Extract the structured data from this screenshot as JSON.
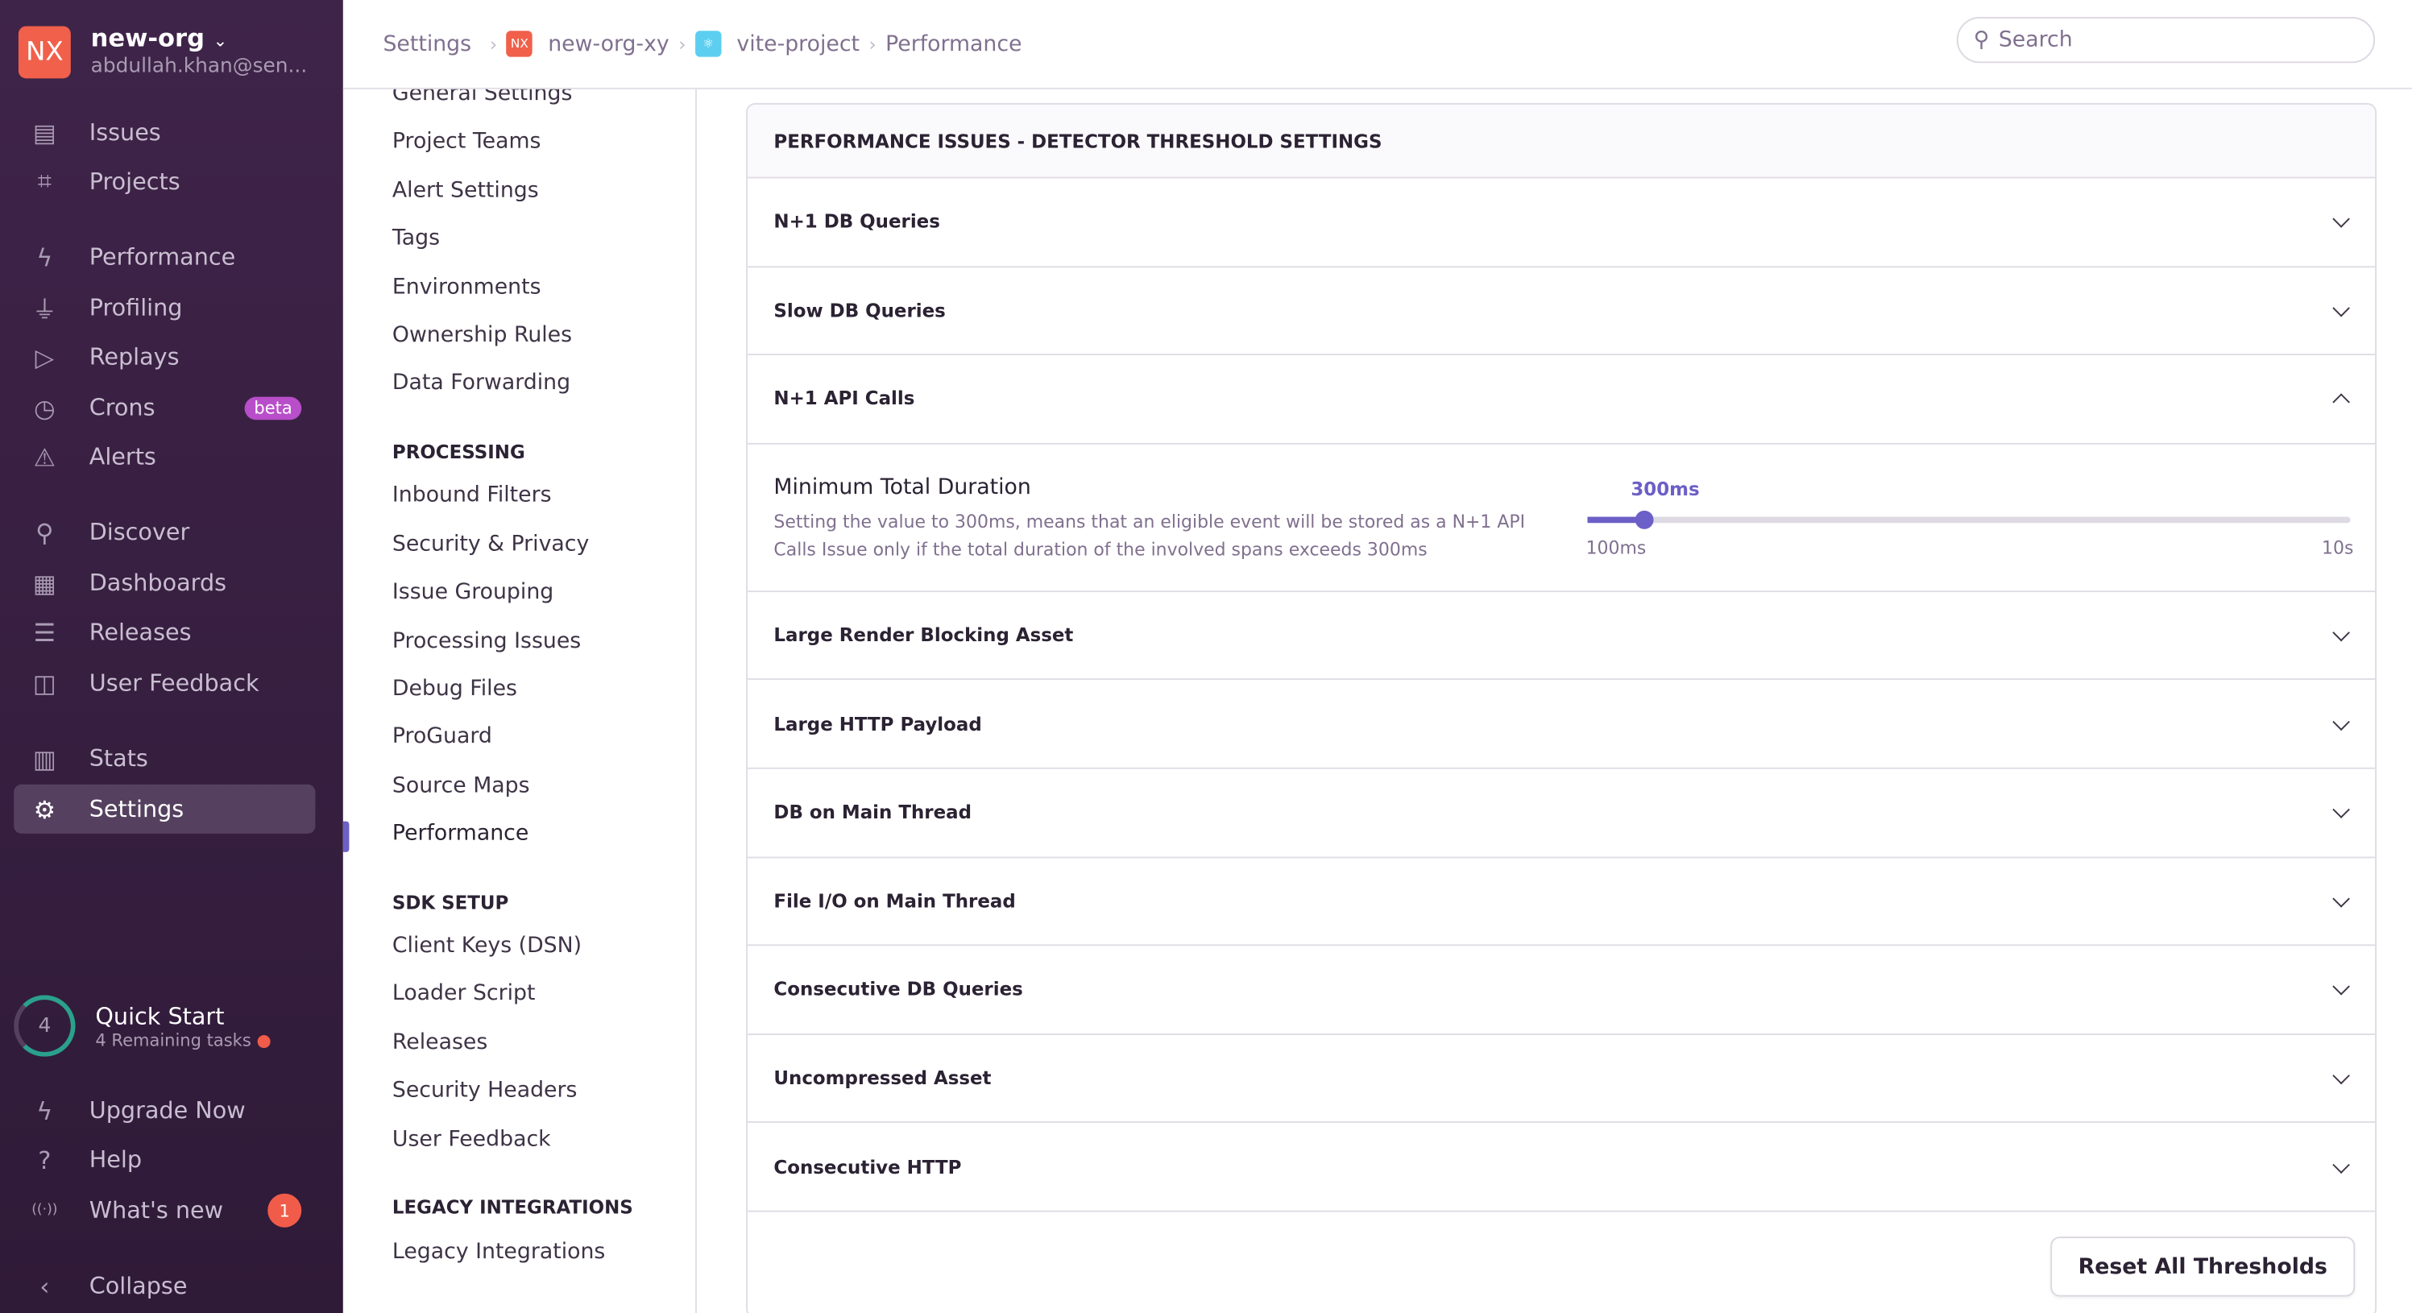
{
  "org": {
    "logo": "NX",
    "name": "new-org",
    "email": "abdullah.khan@sen..."
  },
  "sidebar": {
    "items": [
      {
        "label": "Issues",
        "icon": "issues-icon"
      },
      {
        "label": "Projects",
        "icon": "projects-icon"
      },
      {
        "label": "Performance",
        "icon": "lightning-icon"
      },
      {
        "label": "Profiling",
        "icon": "profiling-icon"
      },
      {
        "label": "Replays",
        "icon": "play-icon"
      },
      {
        "label": "Crons",
        "icon": "clock-icon",
        "badge": "beta"
      },
      {
        "label": "Alerts",
        "icon": "siren-icon"
      },
      {
        "label": "Discover",
        "icon": "telescope-icon"
      },
      {
        "label": "Dashboards",
        "icon": "dashboard-icon"
      },
      {
        "label": "Releases",
        "icon": "releases-icon"
      },
      {
        "label": "User Feedback",
        "icon": "megaphone-icon"
      },
      {
        "label": "Stats",
        "icon": "stats-icon"
      },
      {
        "label": "Settings",
        "icon": "gear-icon",
        "active": true
      }
    ],
    "quick_start": {
      "count": "4",
      "title": "Quick Start",
      "subtitle": "4 Remaining tasks"
    },
    "bottom": [
      {
        "label": "Upgrade Now",
        "icon": "upgrade-icon"
      },
      {
        "label": "Help",
        "icon": "help-icon"
      },
      {
        "label": "What's new",
        "icon": "broadcast-icon",
        "badge": "1"
      },
      {
        "label": "Collapse",
        "icon": "chevron-left-icon"
      }
    ]
  },
  "breadcrumb": [
    "Settings",
    "new-org-xy",
    "vite-project",
    "Performance"
  ],
  "breadcrumb_org_logo": "NX",
  "search": {
    "placeholder": "Search"
  },
  "settings_nav": {
    "items_top": [
      "General Settings",
      "Project Teams",
      "Alert Settings",
      "Tags",
      "Environments",
      "Ownership Rules",
      "Data Forwarding"
    ],
    "processing_header": "PROCESSING",
    "processing": [
      "Inbound Filters",
      "Security & Privacy",
      "Issue Grouping",
      "Processing Issues",
      "Debug Files",
      "ProGuard",
      "Source Maps",
      "Performance"
    ],
    "sdk_header": "SDK SETUP",
    "sdk": [
      "Client Keys (DSN)",
      "Loader Script",
      "Releases",
      "Security Headers",
      "User Feedback"
    ],
    "legacy_header": "LEGACY INTEGRATIONS",
    "legacy": [
      "Legacy Integrations"
    ]
  },
  "panel": {
    "title": "PERFORMANCE ISSUES - DETECTOR THRESHOLD SETTINGS",
    "rows": [
      "N+1 DB Queries",
      "Slow DB Queries",
      "N+1 API Calls",
      "Large Render Blocking Asset",
      "Large HTTP Payload",
      "DB on Main Thread",
      "File I/O on Main Thread",
      "Consecutive DB Queries",
      "Uncompressed Asset",
      "Consecutive HTTP"
    ],
    "expanded": {
      "title": "Minimum Total Duration",
      "description": "Setting the value to 300ms, means that an eligible event will be stored as a N+1 API Calls Issue only if the total duration of the involved spans exceeds 300ms",
      "value": "300ms",
      "min": "100ms",
      "max": "10s",
      "fraction": 0.075
    },
    "reset_label": "Reset All Thresholds"
  },
  "colors": {
    "accent": "#6c5fc7",
    "sidebar": "#3f2449",
    "org_logo": "#f0604b"
  }
}
